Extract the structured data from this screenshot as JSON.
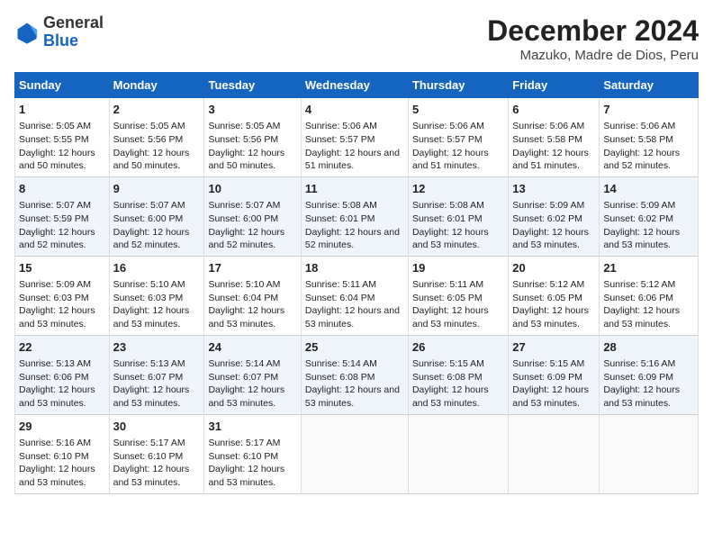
{
  "logo": {
    "line1": "General",
    "line2": "Blue"
  },
  "title": "December 2024",
  "subtitle": "Mazuko, Madre de Dios, Peru",
  "days_of_week": [
    "Sunday",
    "Monday",
    "Tuesday",
    "Wednesday",
    "Thursday",
    "Friday",
    "Saturday"
  ],
  "weeks": [
    [
      {
        "day": "1",
        "sunrise": "5:05 AM",
        "sunset": "5:55 PM",
        "daylight": "12 hours and 50 minutes."
      },
      {
        "day": "2",
        "sunrise": "5:05 AM",
        "sunset": "5:56 PM",
        "daylight": "12 hours and 50 minutes."
      },
      {
        "day": "3",
        "sunrise": "5:05 AM",
        "sunset": "5:56 PM",
        "daylight": "12 hours and 50 minutes."
      },
      {
        "day": "4",
        "sunrise": "5:06 AM",
        "sunset": "5:57 PM",
        "daylight": "12 hours and 51 minutes."
      },
      {
        "day": "5",
        "sunrise": "5:06 AM",
        "sunset": "5:57 PM",
        "daylight": "12 hours and 51 minutes."
      },
      {
        "day": "6",
        "sunrise": "5:06 AM",
        "sunset": "5:58 PM",
        "daylight": "12 hours and 51 minutes."
      },
      {
        "day": "7",
        "sunrise": "5:06 AM",
        "sunset": "5:58 PM",
        "daylight": "12 hours and 52 minutes."
      }
    ],
    [
      {
        "day": "8",
        "sunrise": "5:07 AM",
        "sunset": "5:59 PM",
        "daylight": "12 hours and 52 minutes."
      },
      {
        "day": "9",
        "sunrise": "5:07 AM",
        "sunset": "6:00 PM",
        "daylight": "12 hours and 52 minutes."
      },
      {
        "day": "10",
        "sunrise": "5:07 AM",
        "sunset": "6:00 PM",
        "daylight": "12 hours and 52 minutes."
      },
      {
        "day": "11",
        "sunrise": "5:08 AM",
        "sunset": "6:01 PM",
        "daylight": "12 hours and 52 minutes."
      },
      {
        "day": "12",
        "sunrise": "5:08 AM",
        "sunset": "6:01 PM",
        "daylight": "12 hours and 53 minutes."
      },
      {
        "day": "13",
        "sunrise": "5:09 AM",
        "sunset": "6:02 PM",
        "daylight": "12 hours and 53 minutes."
      },
      {
        "day": "14",
        "sunrise": "5:09 AM",
        "sunset": "6:02 PM",
        "daylight": "12 hours and 53 minutes."
      }
    ],
    [
      {
        "day": "15",
        "sunrise": "5:09 AM",
        "sunset": "6:03 PM",
        "daylight": "12 hours and 53 minutes."
      },
      {
        "day": "16",
        "sunrise": "5:10 AM",
        "sunset": "6:03 PM",
        "daylight": "12 hours and 53 minutes."
      },
      {
        "day": "17",
        "sunrise": "5:10 AM",
        "sunset": "6:04 PM",
        "daylight": "12 hours and 53 minutes."
      },
      {
        "day": "18",
        "sunrise": "5:11 AM",
        "sunset": "6:04 PM",
        "daylight": "12 hours and 53 minutes."
      },
      {
        "day": "19",
        "sunrise": "5:11 AM",
        "sunset": "6:05 PM",
        "daylight": "12 hours and 53 minutes."
      },
      {
        "day": "20",
        "sunrise": "5:12 AM",
        "sunset": "6:05 PM",
        "daylight": "12 hours and 53 minutes."
      },
      {
        "day": "21",
        "sunrise": "5:12 AM",
        "sunset": "6:06 PM",
        "daylight": "12 hours and 53 minutes."
      }
    ],
    [
      {
        "day": "22",
        "sunrise": "5:13 AM",
        "sunset": "6:06 PM",
        "daylight": "12 hours and 53 minutes."
      },
      {
        "day": "23",
        "sunrise": "5:13 AM",
        "sunset": "6:07 PM",
        "daylight": "12 hours and 53 minutes."
      },
      {
        "day": "24",
        "sunrise": "5:14 AM",
        "sunset": "6:07 PM",
        "daylight": "12 hours and 53 minutes."
      },
      {
        "day": "25",
        "sunrise": "5:14 AM",
        "sunset": "6:08 PM",
        "daylight": "12 hours and 53 minutes."
      },
      {
        "day": "26",
        "sunrise": "5:15 AM",
        "sunset": "6:08 PM",
        "daylight": "12 hours and 53 minutes."
      },
      {
        "day": "27",
        "sunrise": "5:15 AM",
        "sunset": "6:09 PM",
        "daylight": "12 hours and 53 minutes."
      },
      {
        "day": "28",
        "sunrise": "5:16 AM",
        "sunset": "6:09 PM",
        "daylight": "12 hours and 53 minutes."
      }
    ],
    [
      {
        "day": "29",
        "sunrise": "5:16 AM",
        "sunset": "6:10 PM",
        "daylight": "12 hours and 53 minutes."
      },
      {
        "day": "30",
        "sunrise": "5:17 AM",
        "sunset": "6:10 PM",
        "daylight": "12 hours and 53 minutes."
      },
      {
        "day": "31",
        "sunrise": "5:17 AM",
        "sunset": "6:10 PM",
        "daylight": "12 hours and 53 minutes."
      },
      null,
      null,
      null,
      null
    ]
  ]
}
